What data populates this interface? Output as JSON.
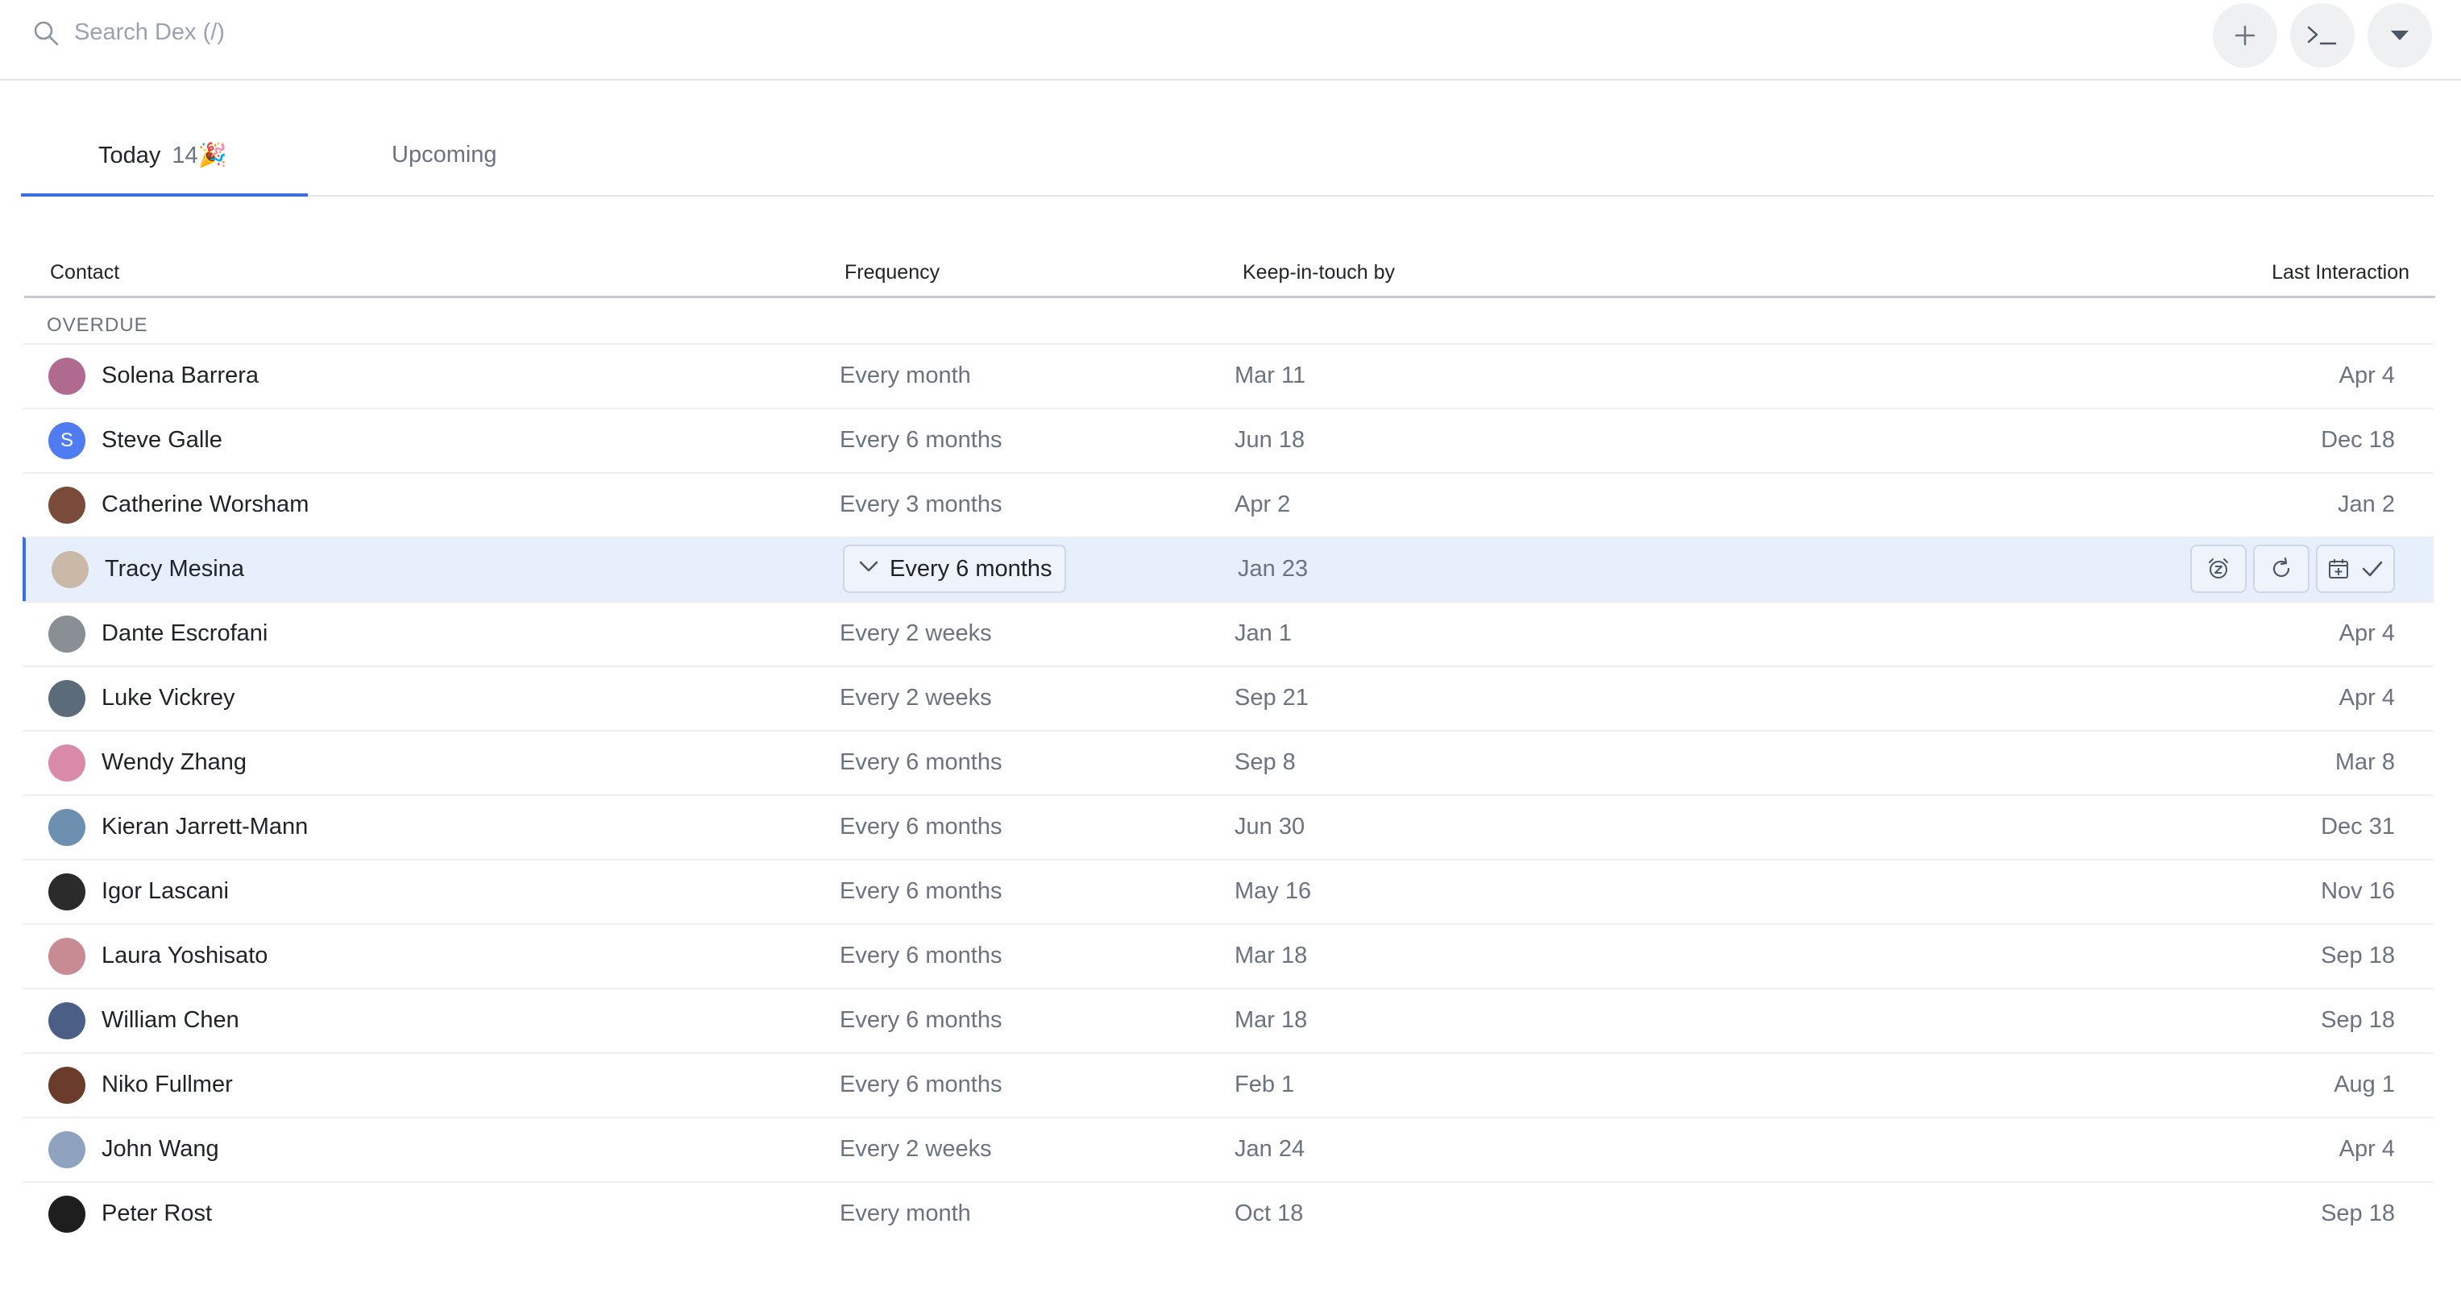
{
  "search": {
    "placeholder": "Search Dex (/)"
  },
  "header_buttons": {
    "add": "plus-icon",
    "terminal": "terminal-icon",
    "menu": "caret-down-icon"
  },
  "tabs": [
    {
      "label": "Today",
      "count": "14",
      "emoji": "🎉",
      "active": true
    },
    {
      "label": "Upcoming",
      "active": false
    }
  ],
  "table": {
    "columns": {
      "contact": "Contact",
      "frequency": "Frequency",
      "keep": "Keep-in-touch by",
      "last": "Last Interaction"
    },
    "section": "OVERDUE",
    "rows": [
      {
        "name": "Solena Barrera",
        "frequency": "Every month",
        "keep_by": "Mar 11",
        "last": "Apr 4",
        "avatar_color": "#b06a8f"
      },
      {
        "name": "Steve Galle",
        "frequency": "Every 6 months",
        "keep_by": "Jun 18",
        "last": "Dec 18",
        "avatar_color": "#4f7cf0",
        "avatar_initial": "S"
      },
      {
        "name": "Catherine Worsham",
        "frequency": "Every 3 months",
        "keep_by": "Apr 2",
        "last": "Jan 2",
        "avatar_color": "#7a4a3a"
      },
      {
        "name": "Tracy Mesina",
        "frequency": "Every 6 months",
        "keep_by": "Jan 23",
        "last": "",
        "avatar_color": "#c9b9a6",
        "selected": true
      },
      {
        "name": "Dante Escrofani",
        "frequency": "Every 2 weeks",
        "keep_by": "Jan 1",
        "last": "Apr 4",
        "avatar_color": "#8a8f96"
      },
      {
        "name": "Luke Vickrey",
        "frequency": "Every 2 weeks",
        "keep_by": "Sep 21",
        "last": "Apr 4",
        "avatar_color": "#5b6b7a"
      },
      {
        "name": "Wendy Zhang",
        "frequency": "Every 6 months",
        "keep_by": "Sep 8",
        "last": "Mar 8",
        "avatar_color": "#d98aa8"
      },
      {
        "name": "Kieran Jarrett-Mann",
        "frequency": "Every 6 months",
        "keep_by": "Jun 30",
        "last": "Dec 31",
        "avatar_color": "#6d8fb0"
      },
      {
        "name": "Igor Lascani",
        "frequency": "Every 6 months",
        "keep_by": "May 16",
        "last": "Nov 16",
        "avatar_color": "#2b2b2b"
      },
      {
        "name": "Laura Yoshisato",
        "frequency": "Every 6 months",
        "keep_by": "Mar 18",
        "last": "Sep 18",
        "avatar_color": "#c88a93"
      },
      {
        "name": "William Chen",
        "frequency": "Every 6 months",
        "keep_by": "Mar 18",
        "last": "Sep 18",
        "avatar_color": "#4b5f86"
      },
      {
        "name": "Niko Fullmer",
        "frequency": "Every 6 months",
        "keep_by": "Feb 1",
        "last": "Aug 1",
        "avatar_color": "#6b3b2b"
      },
      {
        "name": "John Wang",
        "frequency": "Every 2 weeks",
        "keep_by": "Jan 24",
        "last": "Apr 4",
        "avatar_color": "#8fa3c0"
      },
      {
        "name": "Peter Rost",
        "frequency": "Every month",
        "keep_by": "Oct 18",
        "last": "Sep 18",
        "avatar_color": "#1e1e1e"
      }
    ],
    "selected_row_actions": [
      "snooze-alarm-icon",
      "refresh-icon",
      "calendar-add-icon",
      "check-icon"
    ]
  },
  "colors": {
    "accent": "#3b6fe0",
    "selected_row": "#e8effc",
    "muted_text": "#6b7280"
  }
}
